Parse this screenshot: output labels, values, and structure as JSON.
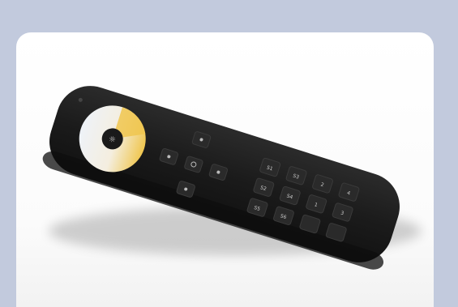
{
  "image": {
    "subject": "black handheld remote control",
    "frame_color": "#c2cadd",
    "card_color": "#ffffff",
    "remote_color": "#1c1c1c",
    "button_color": "#2a2a2a",
    "wheel_colors": [
      "#f6ead0",
      "#f0c64e",
      "#e9eef7"
    ],
    "buttons": {
      "row1": [
        "S1",
        "S3",
        "2",
        "4"
      ],
      "row2": [
        "S2",
        "S4",
        "1",
        "3"
      ],
      "row3": [
        "S5",
        "S6",
        "",
        ""
      ]
    }
  }
}
